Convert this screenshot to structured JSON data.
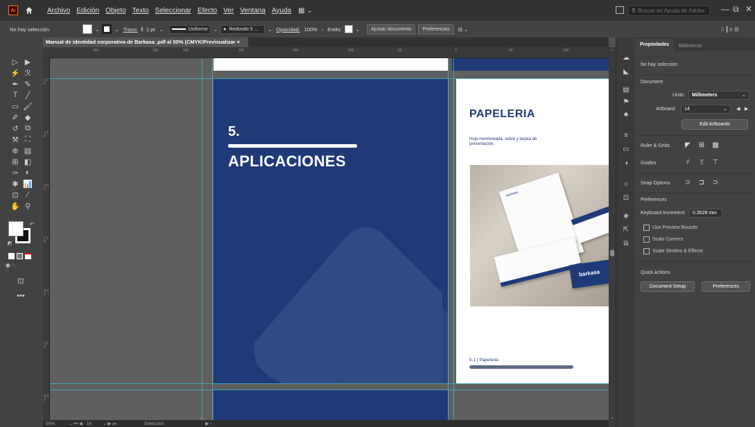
{
  "menubar": {
    "app_logo": "Ai",
    "items": [
      "Archivo",
      "Edición",
      "Objeto",
      "Texto",
      "Seleccionar",
      "Efecto",
      "Ver",
      "Ventana",
      "Ayuda"
    ],
    "search_placeholder": "Buscar en Ayuda de Adobe"
  },
  "controlbar": {
    "selection_status": "No hay selección",
    "stroke_label": "Trazo:",
    "stroke_weight": "1 pt",
    "profile": "Uniforme",
    "brush": "Redondo 5 ...",
    "opacity_label": "Opacidad:",
    "opacity_value": "100%",
    "style_label": "Estilo:",
    "arrange_doc_button": "Ajustar documento",
    "prefs_button": "Preferencias"
  },
  "doc_tab": {
    "title": "Manual de identidad corporativa de Barkasa .pdf al 50% (CMYK/Previsualizar",
    "close": "×"
  },
  "ruler": {
    "h_marks": [
      "350",
      "300",
      "250",
      "200",
      "150",
      "100",
      "50",
      "0",
      "50",
      "100"
    ],
    "v_marks": [
      "1 0 0",
      "1 5 0",
      "2 0 0",
      "2 5 0",
      "3 0 0",
      "3 5 0",
      "4 0 0",
      "4 5 0",
      "5 0 0"
    ]
  },
  "artboard_left": {
    "chapter_number": "5.",
    "chapter_title": "APLICACIONES"
  },
  "artboard_right": {
    "title": "PAPELERIA",
    "description": "Hoja membretada, sobre y tarjeta de presentación.",
    "brand_on_paper": "barkasa",
    "footer_label": "5.1 | Papeleria"
  },
  "status": {
    "zoom": "50%",
    "artboard": "14",
    "tool": "Selección"
  },
  "properties": {
    "tabs": [
      "Propiedades",
      "Bibliotecas"
    ],
    "selection_status": "No hay selección",
    "document_header": "Document",
    "units_label": "Units:",
    "units_value": "Millimeters",
    "artboard_label": "Artboard:",
    "artboard_value": "14",
    "edit_artboards_button": "Edit Artboards",
    "ruler_grids_label": "Ruler & Grids",
    "guides_label": "Guides",
    "snap_label": "Snap Options",
    "preferences_header": "Preferences",
    "keyboard_increment_label": "Keyboard Increment:",
    "keyboard_increment_value": "0.3528 mm",
    "checkboxes": [
      "Use Preview Bounds",
      "Scale Corners",
      "Scale Strokes & Effects"
    ],
    "quick_actions_header": "Quick Actions",
    "document_setup_button": "Document Setup",
    "preferences_button": "Preferences"
  },
  "colors": {
    "navy": "#1f3a77",
    "guide": "#3fb6c4",
    "ui_dark": "#323232",
    "ui_panel": "#424242"
  }
}
